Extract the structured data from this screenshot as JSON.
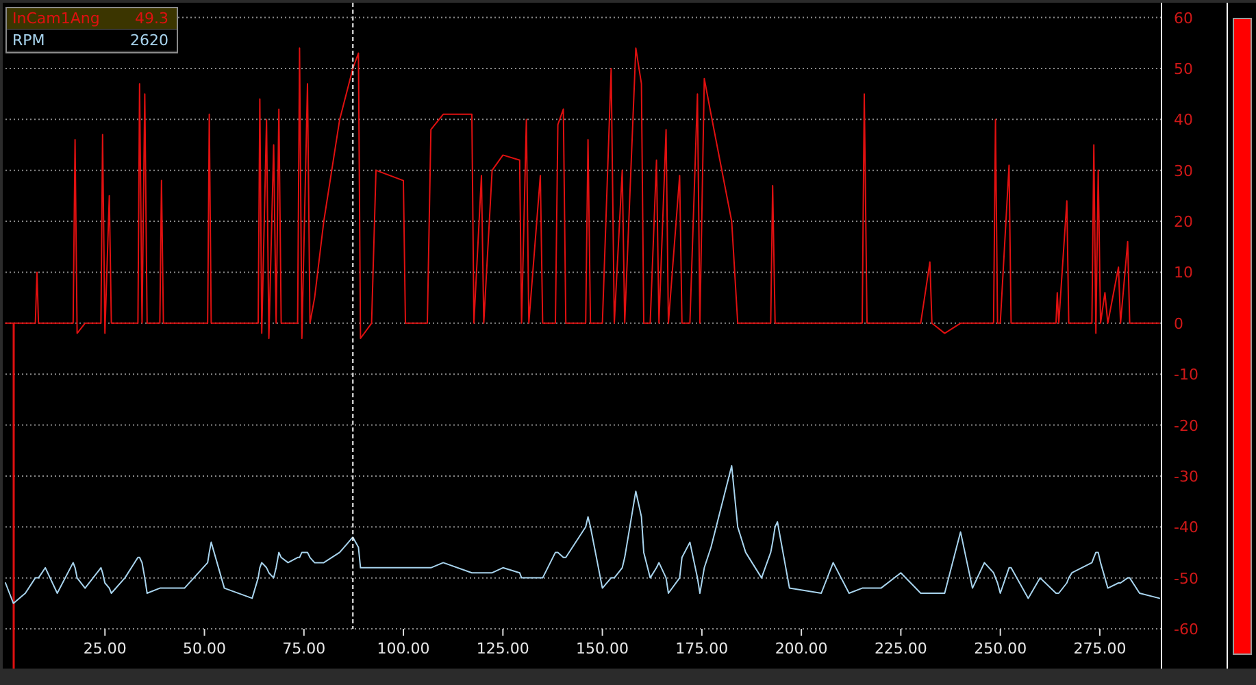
{
  "legend": [
    {
      "value": "49.3",
      "selected": true
    },
    {
      "value": "2620",
      "selected": false
    }
  ],
  "chart_data": {
    "type": "line",
    "grid": true,
    "xlim": [
      0,
      290.5
    ],
    "ylim": [
      -60,
      62.9
    ],
    "xticks": [
      {
        "value": 25,
        "label": "25.00"
      },
      {
        "value": 50,
        "label": "50.00"
      },
      {
        "value": 75,
        "label": "75.00"
      },
      {
        "value": 100,
        "label": "100.00"
      },
      {
        "value": 125,
        "label": "125.00"
      },
      {
        "value": 150,
        "label": "150.00"
      },
      {
        "value": 175,
        "label": "175.00"
      },
      {
        "value": 200,
        "label": "200.00"
      },
      {
        "value": 225,
        "label": "225.00"
      },
      {
        "value": 250,
        "label": "250.00"
      },
      {
        "value": 275,
        "label": "275.00"
      }
    ],
    "yticks": [
      60,
      50,
      40,
      30,
      20,
      10,
      0,
      -10,
      -20,
      -30,
      -40,
      -50,
      -60
    ],
    "ref_lines": [
      {
        "axis": "x",
        "value": 87.3
      }
    ],
    "x": [
      0,
      1,
      2,
      5,
      7.5,
      7.9,
      8.3,
      10,
      13,
      17,
      17.5,
      18,
      20,
      24,
      24.4,
      25,
      26.1,
      26.6,
      30,
      33.3,
      33.7,
      34.3,
      35,
      35.6,
      38.8,
      39.2,
      39.7,
      45,
      50.8,
      51.2,
      51.7,
      55,
      62,
      63.5,
      63.9,
      64.4,
      65.6,
      66.2,
      67.4,
      68,
      68.7,
      69.3,
      71,
      73.4,
      73.9,
      74.5,
      75.9,
      76.5,
      77.7,
      80,
      84,
      87.3,
      88.7,
      89.2,
      92,
      93.1,
      100,
      100.5,
      106,
      106.9,
      110,
      117.2,
      117.7,
      119.6,
      120.2,
      122.3,
      125,
      129.2,
      129.7,
      130.9,
      131.5,
      134.4,
      135,
      138.2,
      138.8,
      140.2,
      140.8,
      145.8,
      146.4,
      147,
      150,
      152.2,
      153,
      155,
      155.6,
      158.4,
      159.8,
      160.4,
      162,
      163.6,
      164.2,
      166,
      166.6,
      169.4,
      170,
      172,
      173.9,
      174.5,
      175.6,
      177.3,
      182.5,
      184,
      186,
      190,
      192.3,
      192.8,
      193.4,
      194,
      197,
      205,
      208,
      212,
      215.3,
      215.8,
      216.5,
      220,
      225,
      230,
      232.3,
      232.8,
      236,
      240,
      243,
      246,
      248.3,
      248.8,
      249.3,
      250,
      252.2,
      252.7,
      257,
      260,
      264,
      264.3,
      264.7,
      266.7,
      267.2,
      268,
      273,
      273.5,
      274,
      274.6,
      275.2,
      276.3,
      277,
      279.7,
      280.2,
      282,
      282.5,
      285,
      290
    ],
    "series": [
      {
        "name": "InCam1Ang",
        "color": "#e01010",
        "values": [
          0,
          0,
          0,
          0,
          0,
          10,
          0,
          0,
          0,
          0,
          36,
          -2,
          0,
          0,
          37,
          -2,
          25,
          0,
          0,
          0,
          47,
          0,
          45,
          0,
          0,
          28,
          0,
          0,
          0,
          41,
          0,
          0,
          0,
          0,
          44,
          -2,
          40,
          -3,
          35,
          0,
          42,
          0,
          0,
          0,
          54,
          -3,
          47,
          0,
          5,
          20,
          40,
          50,
          53,
          -3,
          0,
          30,
          28,
          0,
          0,
          38,
          41,
          41,
          0,
          29,
          0,
          30,
          33,
          32,
          0,
          40,
          0,
          29,
          0,
          0,
          39,
          42,
          0,
          0,
          36,
          0,
          0,
          50,
          0,
          30,
          0,
          54,
          47,
          0,
          0,
          32,
          0,
          38,
          0,
          29,
          0,
          0,
          45,
          0,
          48,
          41,
          20,
          0,
          0,
          0,
          0,
          27,
          0,
          0,
          0,
          0,
          0,
          0,
          0,
          45,
          0,
          0,
          0,
          0,
          12,
          0,
          -2,
          0,
          0,
          0,
          0,
          40,
          0,
          0,
          31,
          0,
          0,
          0,
          0,
          6,
          0,
          24,
          0,
          0,
          0,
          35,
          -2,
          30,
          0,
          6,
          0,
          11,
          0,
          16,
          0,
          0,
          0
        ]
      },
      {
        "name": "RPM",
        "color": "#a8d4ee",
        "values": [
          -51,
          -53,
          -55,
          -53,
          -50,
          -50,
          -50,
          -48,
          -53,
          -47,
          -48,
          -50,
          -52,
          -48,
          -49,
          -51,
          -52,
          -53,
          -50,
          -46,
          -46,
          -47,
          -50,
          -53,
          -52,
          -52,
          -52,
          -52,
          -47,
          -45,
          -43,
          -52,
          -54,
          -50,
          -48,
          -47,
          -48,
          -49,
          -50,
          -48,
          -45,
          -46,
          -47,
          -46,
          -46,
          -45,
          -45,
          -46,
          -47,
          -47,
          -45,
          -42,
          -44,
          -48,
          -48,
          -48,
          -48,
          -48,
          -48,
          -48,
          -47,
          -49,
          -49,
          -49,
          -49,
          -49,
          -48,
          -49,
          -50,
          -50,
          -50,
          -50,
          -50,
          -45,
          -45,
          -46,
          -46,
          -40,
          -38,
          -40,
          -52,
          -50,
          -50,
          -48,
          -46,
          -33,
          -38,
          -45,
          -50,
          -48,
          -47,
          -50,
          -53,
          -50,
          -46,
          -43,
          -50,
          -53,
          -48,
          -44,
          -28,
          -40,
          -45,
          -50,
          -45,
          -43,
          -40,
          -39,
          -52,
          -53,
          -47,
          -53,
          -52,
          -52,
          -52,
          -52,
          -49,
          -53,
          -53,
          -53,
          -53,
          -41,
          -52,
          -47,
          -49,
          -50,
          -51,
          -53,
          -48,
          -48,
          -54,
          -50,
          -53,
          -53,
          -53,
          -51,
          -50,
          -49,
          -47,
          -46,
          -45,
          -45,
          -47,
          -50,
          -52,
          -51,
          -51,
          -50,
          -50,
          -53,
          -54
        ]
      }
    ]
  }
}
